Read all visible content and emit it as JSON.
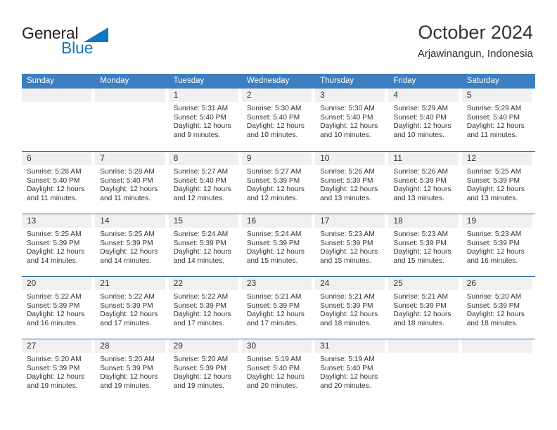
{
  "brand": {
    "name_top": "General",
    "name_bottom": "Blue",
    "accent_color": "#1278be"
  },
  "header": {
    "title": "October 2024",
    "subtitle": "Arjawinangun, Indonesia",
    "weekday_header_color": "#3c7ebf",
    "weekday_text_color": "#ffffff",
    "day_band_color": "#f0f0f0",
    "row_divider_color": "#2f6ca8"
  },
  "weekdays": [
    "Sunday",
    "Monday",
    "Tuesday",
    "Wednesday",
    "Thursday",
    "Friday",
    "Saturday"
  ],
  "weeks": [
    [
      {
        "day": "",
        "lines": []
      },
      {
        "day": "",
        "lines": []
      },
      {
        "day": "1",
        "lines": [
          "Sunrise: 5:31 AM",
          "Sunset: 5:40 PM",
          "Daylight: 12 hours",
          "and 9 minutes."
        ]
      },
      {
        "day": "2",
        "lines": [
          "Sunrise: 5:30 AM",
          "Sunset: 5:40 PM",
          "Daylight: 12 hours",
          "and 10 minutes."
        ]
      },
      {
        "day": "3",
        "lines": [
          "Sunrise: 5:30 AM",
          "Sunset: 5:40 PM",
          "Daylight: 12 hours",
          "and 10 minutes."
        ]
      },
      {
        "day": "4",
        "lines": [
          "Sunrise: 5:29 AM",
          "Sunset: 5:40 PM",
          "Daylight: 12 hours",
          "and 10 minutes."
        ]
      },
      {
        "day": "5",
        "lines": [
          "Sunrise: 5:29 AM",
          "Sunset: 5:40 PM",
          "Daylight: 12 hours",
          "and 11 minutes."
        ]
      }
    ],
    [
      {
        "day": "6",
        "lines": [
          "Sunrise: 5:28 AM",
          "Sunset: 5:40 PM",
          "Daylight: 12 hours",
          "and 11 minutes."
        ]
      },
      {
        "day": "7",
        "lines": [
          "Sunrise: 5:28 AM",
          "Sunset: 5:40 PM",
          "Daylight: 12 hours",
          "and 11 minutes."
        ]
      },
      {
        "day": "8",
        "lines": [
          "Sunrise: 5:27 AM",
          "Sunset: 5:40 PM",
          "Daylight: 12 hours",
          "and 12 minutes."
        ]
      },
      {
        "day": "9",
        "lines": [
          "Sunrise: 5:27 AM",
          "Sunset: 5:39 PM",
          "Daylight: 12 hours",
          "and 12 minutes."
        ]
      },
      {
        "day": "10",
        "lines": [
          "Sunrise: 5:26 AM",
          "Sunset: 5:39 PM",
          "Daylight: 12 hours",
          "and 13 minutes."
        ]
      },
      {
        "day": "11",
        "lines": [
          "Sunrise: 5:26 AM",
          "Sunset: 5:39 PM",
          "Daylight: 12 hours",
          "and 13 minutes."
        ]
      },
      {
        "day": "12",
        "lines": [
          "Sunrise: 5:25 AM",
          "Sunset: 5:39 PM",
          "Daylight: 12 hours",
          "and 13 minutes."
        ]
      }
    ],
    [
      {
        "day": "13",
        "lines": [
          "Sunrise: 5:25 AM",
          "Sunset: 5:39 PM",
          "Daylight: 12 hours",
          "and 14 minutes."
        ]
      },
      {
        "day": "14",
        "lines": [
          "Sunrise: 5:25 AM",
          "Sunset: 5:39 PM",
          "Daylight: 12 hours",
          "and 14 minutes."
        ]
      },
      {
        "day": "15",
        "lines": [
          "Sunrise: 5:24 AM",
          "Sunset: 5:39 PM",
          "Daylight: 12 hours",
          "and 14 minutes."
        ]
      },
      {
        "day": "16",
        "lines": [
          "Sunrise: 5:24 AM",
          "Sunset: 5:39 PM",
          "Daylight: 12 hours",
          "and 15 minutes."
        ]
      },
      {
        "day": "17",
        "lines": [
          "Sunrise: 5:23 AM",
          "Sunset: 5:39 PM",
          "Daylight: 12 hours",
          "and 15 minutes."
        ]
      },
      {
        "day": "18",
        "lines": [
          "Sunrise: 5:23 AM",
          "Sunset: 5:39 PM",
          "Daylight: 12 hours",
          "and 15 minutes."
        ]
      },
      {
        "day": "19",
        "lines": [
          "Sunrise: 5:23 AM",
          "Sunset: 5:39 PM",
          "Daylight: 12 hours",
          "and 16 minutes."
        ]
      }
    ],
    [
      {
        "day": "20",
        "lines": [
          "Sunrise: 5:22 AM",
          "Sunset: 5:39 PM",
          "Daylight: 12 hours",
          "and 16 minutes."
        ]
      },
      {
        "day": "21",
        "lines": [
          "Sunrise: 5:22 AM",
          "Sunset: 5:39 PM",
          "Daylight: 12 hours",
          "and 17 minutes."
        ]
      },
      {
        "day": "22",
        "lines": [
          "Sunrise: 5:22 AM",
          "Sunset: 5:39 PM",
          "Daylight: 12 hours",
          "and 17 minutes."
        ]
      },
      {
        "day": "23",
        "lines": [
          "Sunrise: 5:21 AM",
          "Sunset: 5:39 PM",
          "Daylight: 12 hours",
          "and 17 minutes."
        ]
      },
      {
        "day": "24",
        "lines": [
          "Sunrise: 5:21 AM",
          "Sunset: 5:39 PM",
          "Daylight: 12 hours",
          "and 18 minutes."
        ]
      },
      {
        "day": "25",
        "lines": [
          "Sunrise: 5:21 AM",
          "Sunset: 5:39 PM",
          "Daylight: 12 hours",
          "and 18 minutes."
        ]
      },
      {
        "day": "26",
        "lines": [
          "Sunrise: 5:20 AM",
          "Sunset: 5:39 PM",
          "Daylight: 12 hours",
          "and 18 minutes."
        ]
      }
    ],
    [
      {
        "day": "27",
        "lines": [
          "Sunrise: 5:20 AM",
          "Sunset: 5:39 PM",
          "Daylight: 12 hours",
          "and 19 minutes."
        ]
      },
      {
        "day": "28",
        "lines": [
          "Sunrise: 5:20 AM",
          "Sunset: 5:39 PM",
          "Daylight: 12 hours",
          "and 19 minutes."
        ]
      },
      {
        "day": "29",
        "lines": [
          "Sunrise: 5:20 AM",
          "Sunset: 5:39 PM",
          "Daylight: 12 hours",
          "and 19 minutes."
        ]
      },
      {
        "day": "30",
        "lines": [
          "Sunrise: 5:19 AM",
          "Sunset: 5:40 PM",
          "Daylight: 12 hours",
          "and 20 minutes."
        ]
      },
      {
        "day": "31",
        "lines": [
          "Sunrise: 5:19 AM",
          "Sunset: 5:40 PM",
          "Daylight: 12 hours",
          "and 20 minutes."
        ]
      },
      {
        "day": "",
        "lines": []
      },
      {
        "day": "",
        "lines": []
      }
    ]
  ]
}
